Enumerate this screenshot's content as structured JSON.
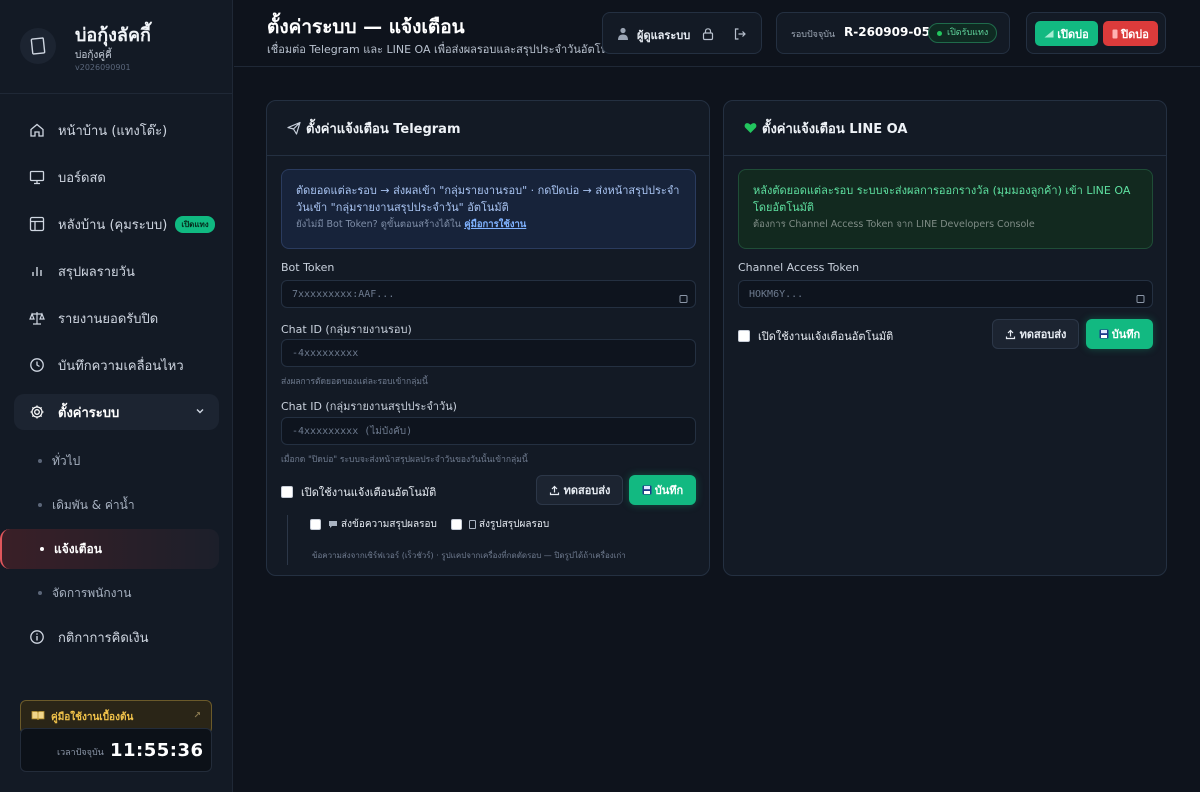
{
  "brand": {
    "title": "บ่อกุ้งลัคกี้",
    "subtitle": "บ่อกุ้งคู่คี้",
    "version": "v2026090901"
  },
  "sidebar": {
    "items": [
      {
        "label": "หน้าบ้าน (แทงโต๊ะ)",
        "icon": "home-icon"
      },
      {
        "label": "บอร์ดสด",
        "icon": "monitor-icon"
      },
      {
        "label": "หลังบ้าน (คุมระบบ)",
        "icon": "layout-icon",
        "badge": "เปิดแทง"
      },
      {
        "label": "สรุปผลรายวัน",
        "icon": "bar-chart-icon"
      },
      {
        "label": "รายงานยอดรับปิด",
        "icon": "scale-icon"
      },
      {
        "label": "บันทึกความเคลื่อนไหว",
        "icon": "clock-icon"
      }
    ],
    "settings": {
      "label": "ตั้งค่าระบบ",
      "children": [
        "ทั่วไป",
        "เดิมพัน & ค่าน้ำ",
        "แจ้งเตือน",
        "จัดการพนักงาน"
      ]
    },
    "billing": {
      "label": "กติกาการคิดเงิน"
    },
    "guide": "คู่มือใช้งานเบื้องต้น",
    "clock_label": "เวลาปัจจุบัน",
    "clock_time": "11:55:36"
  },
  "header": {
    "title": "ตั้งค่าระบบ — แจ้งเตือน",
    "subtitle": "เชื่อมต่อ Telegram และ LINE OA เพื่อส่งผลรอบและสรุปประจำวันอัตโนมัติ",
    "user_name": "ผู้ดูแลระบบ",
    "round_label": "รอบปัจจุบัน",
    "round_value": "R-260909-05",
    "round_status": "เปิดรับแทง",
    "open_button": "เปิดบ่อ",
    "close_button": "ปิดบ่อ"
  },
  "telegram": {
    "title": "ตั้งค่าแจ้งเตือน Telegram",
    "info_text": "ตัดยอดแต่ละรอบ → ส่งผลเข้า \"กลุ่มรายงานรอบ\" · กดปิดบ่อ → ส่งหน้าสรุปประจำวันเข้า \"กลุ่มรายงานสรุปประจำวัน\" อัตโนมัติ",
    "info_muted": "ยังไม่มี Bot Token? ดูขั้นตอนสร้างได้ใน",
    "info_link": "คู่มือการใช้งาน",
    "bot_token_label": "Bot Token",
    "bot_token_placeholder": "7xxxxxxxxx:AAF...",
    "chat_round_label": "Chat ID (กลุ่มรายงานรอบ)",
    "chat_round_placeholder": "-4xxxxxxxxx",
    "chat_round_hint": "ส่งผลการตัดยอดของแต่ละรอบเข้ากลุ่มนี้",
    "chat_daily_label": "Chat ID (กลุ่มรายงานสรุปประจำวัน)",
    "chat_daily_placeholder": "-4xxxxxxxxx (ไม่บังคับ)",
    "chat_daily_hint": "เมื่อกด \"ปิดบ่อ\" ระบบจะส่งหน้าสรุปผลประจำวันของวันนั้นเข้ากลุ่มนี้",
    "enable_label": "เปิดใช้งานแจ้งเตือนอัตโนมัติ",
    "test_button": "ทดสอบส่ง",
    "save_button": "บันทึก",
    "opt_text": "ส่งข้อความสรุปผลรอบ",
    "opt_image": "ส่งรูปสรุปผลรอบ",
    "opt_hint": "ข้อความส่งจากเซิร์ฟเวอร์ (เร็วชัวร์) · รูปแคปจากเครื่องที่กดตัดรอบ — ปิดรูปได้ถ้าเครื่องเก่า"
  },
  "line": {
    "title": "ตั้งค่าแจ้งเตือน LINE OA",
    "info_text": "หลังตัดยอดแต่ละรอบ ระบบจะส่งผลการออกรางวัล (มุมมองลูกค้า) เข้า LINE OA โดยอัตโนมัติ",
    "info_muted": "ต้องการ Channel Access Token จาก LINE Developers Console",
    "token_label": "Channel Access Token",
    "token_placeholder": "HOKM6Y...",
    "enable_label": "เปิดใช้งานแจ้งเตือนอัตโนมัติ",
    "test_button": "ทดสอบส่ง",
    "save_button": "บันทึก"
  },
  "colors": {
    "accent_green": "#12b981",
    "danger_red": "#dc3b3b",
    "active_nav_border": "#e0565b"
  }
}
